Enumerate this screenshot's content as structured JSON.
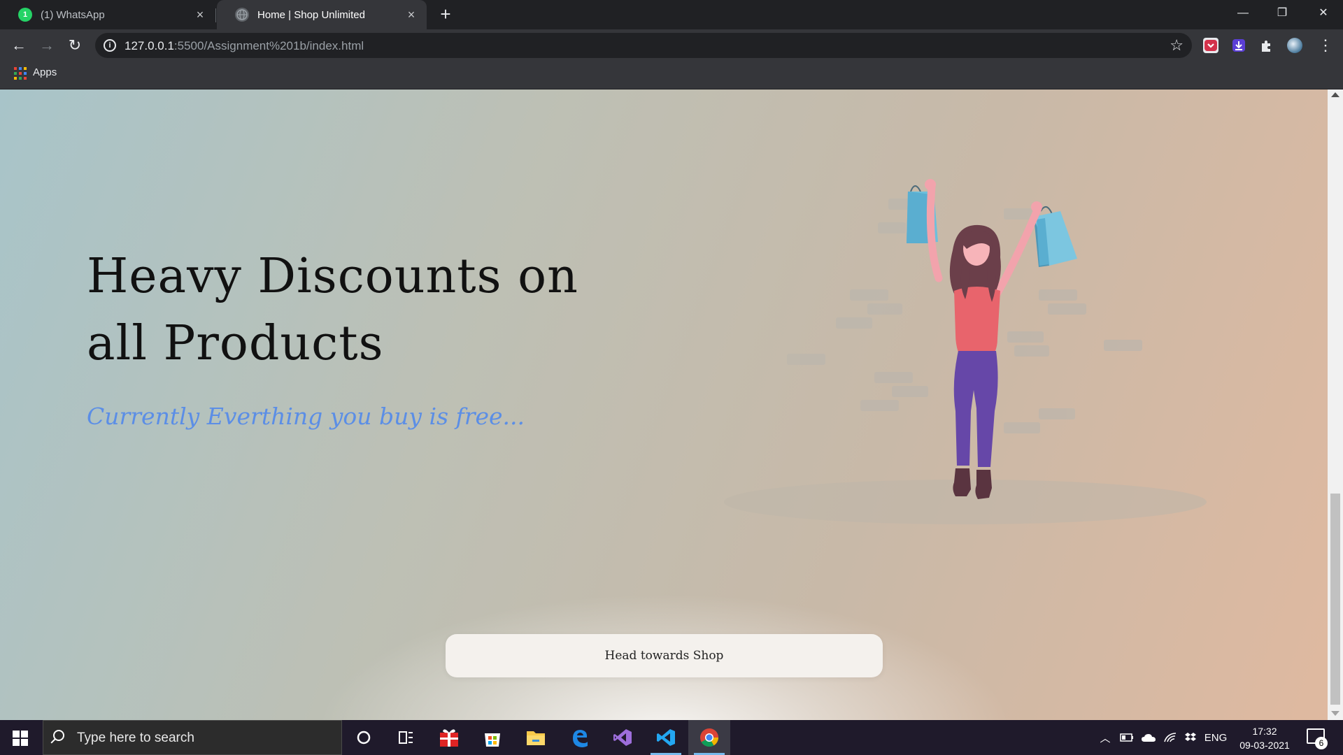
{
  "browser": {
    "tabs": [
      {
        "title": "(1) WhatsApp",
        "icon": "whatsapp-icon",
        "active": false
      },
      {
        "title": "Home | Shop Unlimited",
        "icon": "globe-icon",
        "active": true
      }
    ],
    "new_tab_label": "+",
    "window_controls": {
      "minimize": "—",
      "restore": "❐",
      "close": "✕"
    },
    "address": {
      "host": "127.0.0.1",
      "path": ":5500/Assignment%201b/index.html"
    },
    "bookmarks": {
      "apps_label": "Apps"
    }
  },
  "page": {
    "hero_title": "Heavy Discounts on all Products",
    "hero_subtitle": "Currently Everthing you buy is free...",
    "cta_label": "Head towards Shop",
    "colors": {
      "subtitle": "#5b8ee6",
      "cta_bg": "#f4f1ed",
      "bg_left": "#a8c4c9",
      "bg_right": "#dfb9a0"
    }
  },
  "taskbar": {
    "search_placeholder": "Type here to search",
    "pinned": [
      "cortana-icon",
      "task-view-icon",
      "gift-app-icon",
      "microsoft-store-icon",
      "file-explorer-icon",
      "edge-icon",
      "visual-studio-icon",
      "vscode-icon",
      "chrome-icon"
    ],
    "language": "ENG",
    "time": "17:32",
    "date": "09-03-2021",
    "notification_count": "6"
  }
}
